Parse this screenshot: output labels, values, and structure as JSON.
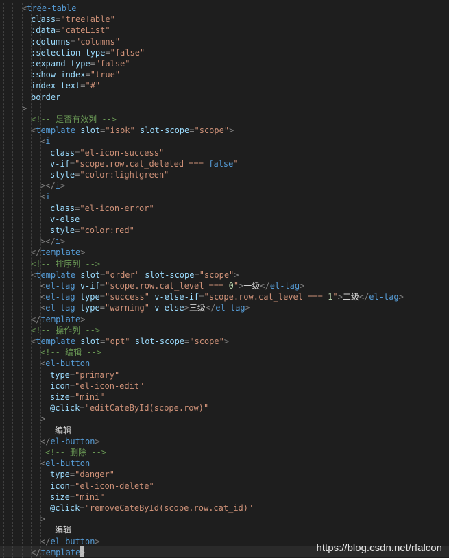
{
  "editor": {
    "lines": [
      [
        [
          "punc",
          "<"
        ],
        [
          "tag",
          "tree-table"
        ]
      ],
      [
        [
          "attr",
          "class"
        ],
        [
          "punc",
          "="
        ],
        [
          "str",
          "\"treeTable\""
        ]
      ],
      [
        [
          "attr",
          ":data"
        ],
        [
          "punc",
          "="
        ],
        [
          "str",
          "\"cateList\""
        ]
      ],
      [
        [
          "attr",
          ":columns"
        ],
        [
          "punc",
          "="
        ],
        [
          "str",
          "\"columns\""
        ]
      ],
      [
        [
          "attr",
          ":selection-type"
        ],
        [
          "punc",
          "="
        ],
        [
          "str",
          "\"false\""
        ]
      ],
      [
        [
          "attr",
          ":expand-type"
        ],
        [
          "punc",
          "="
        ],
        [
          "str",
          "\"false\""
        ]
      ],
      [
        [
          "attr",
          ":show-index"
        ],
        [
          "punc",
          "="
        ],
        [
          "str",
          "\"true\""
        ]
      ],
      [
        [
          "attr",
          "index-text"
        ],
        [
          "punc",
          "="
        ],
        [
          "str",
          "\"#\""
        ]
      ],
      [
        [
          "attr",
          "border"
        ]
      ],
      [
        [
          "punc",
          ">"
        ]
      ],
      [
        [
          "cmt",
          "<!-- 是否有效列 -->"
        ]
      ],
      [
        [
          "punc",
          "<"
        ],
        [
          "tag",
          "template"
        ],
        [
          "txt",
          " "
        ],
        [
          "attr",
          "slot"
        ],
        [
          "punc",
          "="
        ],
        [
          "str",
          "\"isok\""
        ],
        [
          "txt",
          " "
        ],
        [
          "attr",
          "slot-scope"
        ],
        [
          "punc",
          "="
        ],
        [
          "str",
          "\"scope\""
        ],
        [
          "punc",
          ">"
        ]
      ],
      [
        [
          "punc",
          "<"
        ],
        [
          "tag",
          "i"
        ]
      ],
      [
        [
          "attr",
          "class"
        ],
        [
          "punc",
          "="
        ],
        [
          "str",
          "\"el-icon-success\""
        ]
      ],
      [
        [
          "attr",
          "v-if"
        ],
        [
          "punc",
          "="
        ],
        [
          "str",
          "\"scope.row.cat_deleted === "
        ],
        [
          "kw",
          "false"
        ],
        [
          "str",
          "\""
        ]
      ],
      [
        [
          "attr",
          "style"
        ],
        [
          "punc",
          "="
        ],
        [
          "str",
          "\"color:lightgreen\""
        ]
      ],
      [
        [
          "punc",
          "></"
        ],
        [
          "tag",
          "i"
        ],
        [
          "punc",
          ">"
        ]
      ],
      [
        [
          "punc",
          "<"
        ],
        [
          "tag",
          "i"
        ]
      ],
      [
        [
          "attr",
          "class"
        ],
        [
          "punc",
          "="
        ],
        [
          "str",
          "\"el-icon-error\""
        ]
      ],
      [
        [
          "attr",
          "v-else"
        ]
      ],
      [
        [
          "attr",
          "style"
        ],
        [
          "punc",
          "="
        ],
        [
          "str",
          "\"color:red\""
        ]
      ],
      [
        [
          "punc",
          "></"
        ],
        [
          "tag",
          "i"
        ],
        [
          "punc",
          ">"
        ]
      ],
      [
        [
          "punc",
          "</"
        ],
        [
          "tag",
          "template"
        ],
        [
          "punc",
          ">"
        ]
      ],
      [
        [
          "cmt",
          "<!-- 排序列 -->"
        ]
      ],
      [
        [
          "punc",
          "<"
        ],
        [
          "tag",
          "template"
        ],
        [
          "txt",
          " "
        ],
        [
          "attr",
          "slot"
        ],
        [
          "punc",
          "="
        ],
        [
          "str",
          "\"order\""
        ],
        [
          "txt",
          " "
        ],
        [
          "attr",
          "slot-scope"
        ],
        [
          "punc",
          "="
        ],
        [
          "str",
          "\"scope\""
        ],
        [
          "punc",
          ">"
        ]
      ],
      [
        [
          "punc",
          "<"
        ],
        [
          "tag",
          "el-tag"
        ],
        [
          "txt",
          " "
        ],
        [
          "attr",
          "v-if"
        ],
        [
          "punc",
          "="
        ],
        [
          "str",
          "\"scope.row.cat_level === "
        ],
        [
          "num",
          "0"
        ],
        [
          "str",
          "\""
        ],
        [
          "punc",
          ">"
        ],
        [
          "txt",
          "一级"
        ],
        [
          "punc",
          "</"
        ],
        [
          "tag",
          "el-tag"
        ],
        [
          "punc",
          ">"
        ]
      ],
      [
        [
          "punc",
          "<"
        ],
        [
          "tag",
          "el-tag"
        ],
        [
          "txt",
          " "
        ],
        [
          "attr",
          "type"
        ],
        [
          "punc",
          "="
        ],
        [
          "str",
          "\"success\""
        ],
        [
          "txt",
          " "
        ],
        [
          "attr",
          "v-else-if"
        ],
        [
          "punc",
          "="
        ],
        [
          "str",
          "\"scope.row.cat_level === "
        ],
        [
          "num",
          "1"
        ],
        [
          "str",
          "\""
        ],
        [
          "punc",
          ">"
        ],
        [
          "txt",
          "二级"
        ],
        [
          "punc",
          "</"
        ],
        [
          "tag",
          "el-tag"
        ],
        [
          "punc",
          ">"
        ]
      ],
      [
        [
          "punc",
          "<"
        ],
        [
          "tag",
          "el-tag"
        ],
        [
          "txt",
          " "
        ],
        [
          "attr",
          "type"
        ],
        [
          "punc",
          "="
        ],
        [
          "str",
          "\"warning\""
        ],
        [
          "txt",
          " "
        ],
        [
          "attr",
          "v-else"
        ],
        [
          "punc",
          ">"
        ],
        [
          "txt",
          "三级"
        ],
        [
          "punc",
          "</"
        ],
        [
          "tag",
          "el-tag"
        ],
        [
          "punc",
          ">"
        ]
      ],
      [
        [
          "punc",
          "</"
        ],
        [
          "tag",
          "template"
        ],
        [
          "punc",
          ">"
        ]
      ],
      [
        [
          "cmt",
          "<!-- 操作列 -->"
        ]
      ],
      [
        [
          "punc",
          "<"
        ],
        [
          "tag",
          "template"
        ],
        [
          "txt",
          " "
        ],
        [
          "attr",
          "slot"
        ],
        [
          "punc",
          "="
        ],
        [
          "str",
          "\"opt\""
        ],
        [
          "txt",
          " "
        ],
        [
          "attr",
          "slot-scope"
        ],
        [
          "punc",
          "="
        ],
        [
          "str",
          "\"scope\""
        ],
        [
          "punc",
          ">"
        ]
      ],
      [
        [
          "cmt",
          "<!-- 编辑 -->"
        ]
      ],
      [
        [
          "punc",
          "<"
        ],
        [
          "tag",
          "el-button"
        ]
      ],
      [
        [
          "attr",
          "type"
        ],
        [
          "punc",
          "="
        ],
        [
          "str",
          "\"primary\""
        ]
      ],
      [
        [
          "attr",
          "icon"
        ],
        [
          "punc",
          "="
        ],
        [
          "str",
          "\"el-icon-edit\""
        ]
      ],
      [
        [
          "attr",
          "size"
        ],
        [
          "punc",
          "="
        ],
        [
          "str",
          "\"mini\""
        ]
      ],
      [
        [
          "attr",
          "@click"
        ],
        [
          "punc",
          "="
        ],
        [
          "str",
          "\"editCateById(scope.row)\""
        ]
      ],
      [
        [
          "punc",
          ">"
        ]
      ],
      [
        [
          "txt",
          "编辑"
        ]
      ],
      [
        [
          "punc",
          "</"
        ],
        [
          "tag",
          "el-button"
        ],
        [
          "punc",
          ">"
        ]
      ],
      [
        [
          "cmt",
          "<!-- 删除 -->"
        ]
      ],
      [
        [
          "punc",
          "<"
        ],
        [
          "tag",
          "el-button"
        ]
      ],
      [
        [
          "attr",
          "type"
        ],
        [
          "punc",
          "="
        ],
        [
          "str",
          "\"danger\""
        ]
      ],
      [
        [
          "attr",
          "icon"
        ],
        [
          "punc",
          "="
        ],
        [
          "str",
          "\"el-icon-delete\""
        ]
      ],
      [
        [
          "attr",
          "size"
        ],
        [
          "punc",
          "="
        ],
        [
          "str",
          "\"mini\""
        ]
      ],
      [
        [
          "attr",
          "@click"
        ],
        [
          "punc",
          "="
        ],
        [
          "str",
          "\"removeCateById(scope.row.cat_id)\""
        ]
      ],
      [
        [
          "punc",
          ">"
        ]
      ],
      [
        [
          "txt",
          "编辑"
        ]
      ],
      [
        [
          "punc",
          "</"
        ],
        [
          "tag",
          "el-button"
        ],
        [
          "punc",
          ">"
        ]
      ],
      [
        [
          "punc",
          "</"
        ],
        [
          "tag",
          "template"
        ],
        [
          "punc",
          ">"
        ]
      ]
    ]
  },
  "watermark": "https://blog.csdn.net/rfalcon"
}
